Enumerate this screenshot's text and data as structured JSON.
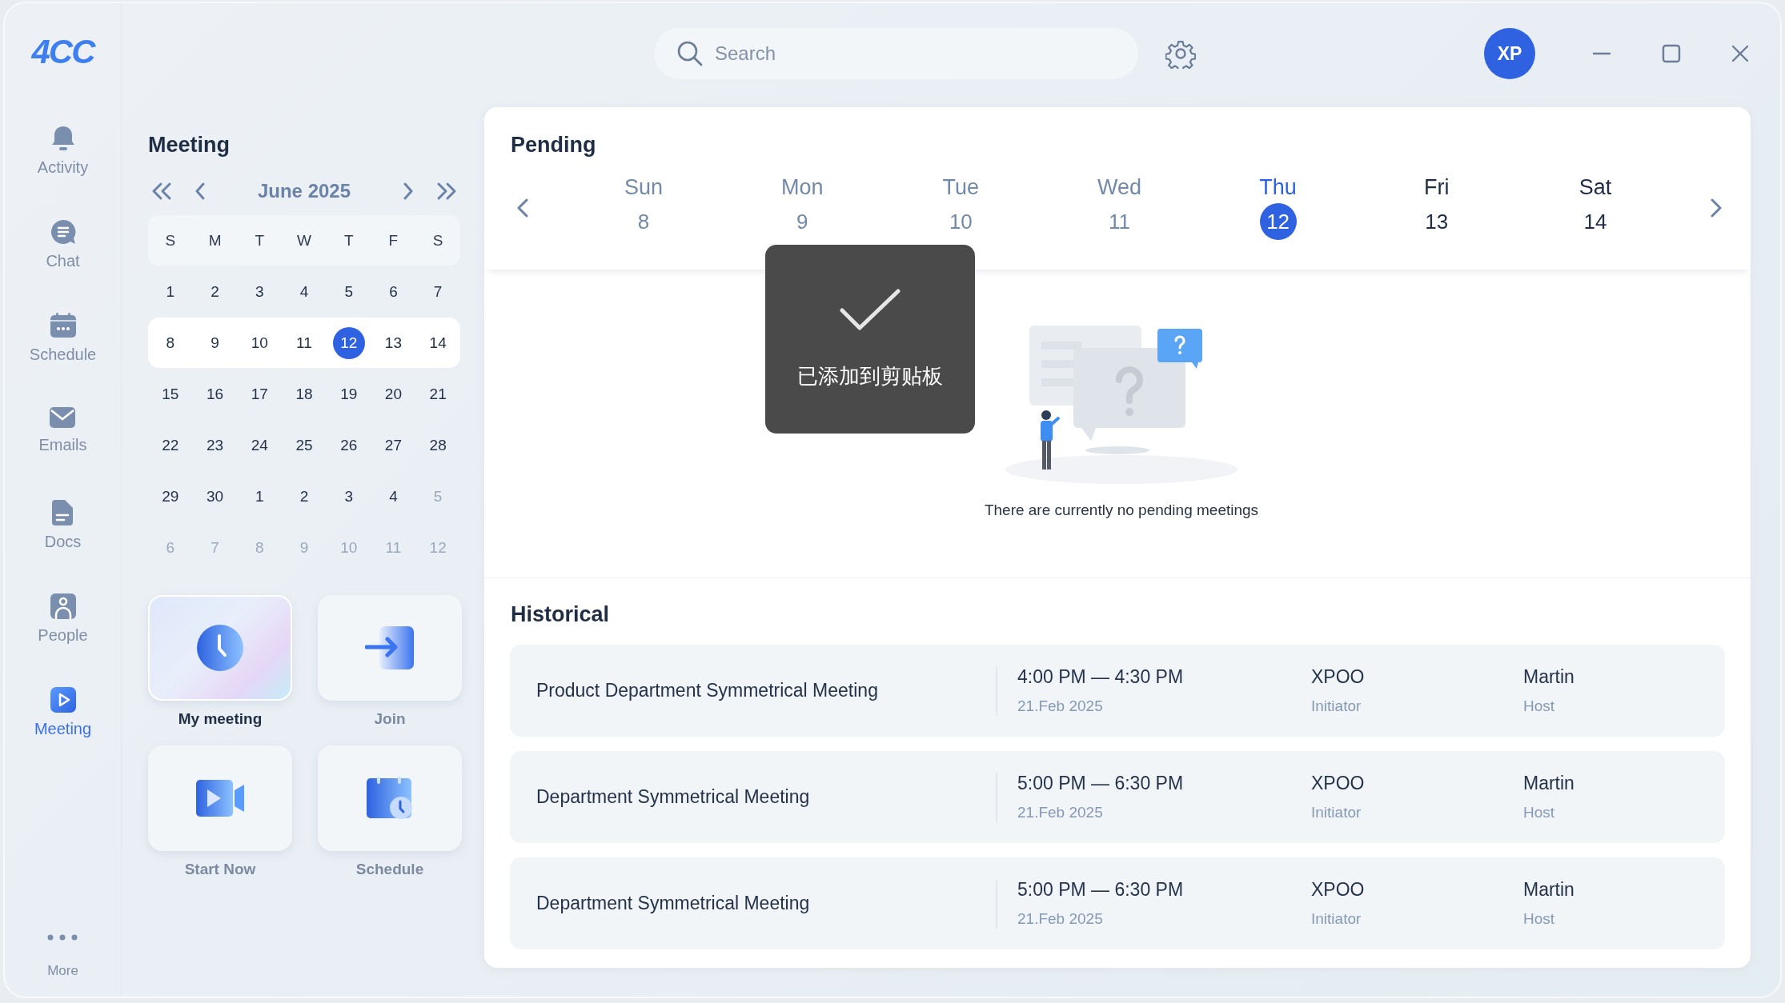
{
  "logo": "4CC",
  "search": {
    "placeholder": "Search"
  },
  "avatar": {
    "initials": "XP"
  },
  "sidebar": {
    "items": [
      {
        "label": "Activity",
        "selected": false
      },
      {
        "label": "Chat",
        "selected": false
      },
      {
        "label": "Schedule",
        "selected": false
      },
      {
        "label": "Emails",
        "selected": false
      },
      {
        "label": "Docs",
        "selected": false
      },
      {
        "label": "People",
        "selected": false
      },
      {
        "label": "Meeting",
        "selected": true
      }
    ],
    "more": {
      "label": "More"
    }
  },
  "meeting_panel": {
    "title": "Meeting",
    "month": "June  2025",
    "weekdays": [
      "S",
      "M",
      "T",
      "W",
      "T",
      "F",
      "S"
    ],
    "weeks": [
      {
        "highlighted": false,
        "days": [
          {
            "day": "1",
            "muted": false,
            "selected": false
          },
          {
            "day": "2",
            "muted": false,
            "selected": false
          },
          {
            "day": "3",
            "muted": false,
            "selected": false
          },
          {
            "day": "4",
            "muted": false,
            "selected": false
          },
          {
            "day": "5",
            "muted": false,
            "selected": false
          },
          {
            "day": "6",
            "muted": false,
            "selected": false
          },
          {
            "day": "7",
            "muted": false,
            "selected": false
          }
        ]
      },
      {
        "highlighted": true,
        "days": [
          {
            "day": "8",
            "muted": false,
            "selected": false
          },
          {
            "day": "9",
            "muted": false,
            "selected": false
          },
          {
            "day": "10",
            "muted": false,
            "selected": false
          },
          {
            "day": "11",
            "muted": false,
            "selected": false
          },
          {
            "day": "12",
            "muted": false,
            "selected": true
          },
          {
            "day": "13",
            "muted": false,
            "selected": false
          },
          {
            "day": "14",
            "muted": false,
            "selected": false
          }
        ]
      },
      {
        "highlighted": false,
        "days": [
          {
            "day": "15",
            "muted": false,
            "selected": false
          },
          {
            "day": "16",
            "muted": false,
            "selected": false
          },
          {
            "day": "17",
            "muted": false,
            "selected": false
          },
          {
            "day": "18",
            "muted": false,
            "selected": false
          },
          {
            "day": "19",
            "muted": false,
            "selected": false
          },
          {
            "day": "20",
            "muted": false,
            "selected": false
          },
          {
            "day": "21",
            "muted": false,
            "selected": false
          }
        ]
      },
      {
        "highlighted": false,
        "days": [
          {
            "day": "22",
            "muted": false,
            "selected": false
          },
          {
            "day": "23",
            "muted": false,
            "selected": false
          },
          {
            "day": "24",
            "muted": false,
            "selected": false
          },
          {
            "day": "25",
            "muted": false,
            "selected": false
          },
          {
            "day": "26",
            "muted": false,
            "selected": false
          },
          {
            "day": "27",
            "muted": false,
            "selected": false
          },
          {
            "day": "28",
            "muted": false,
            "selected": false
          }
        ]
      },
      {
        "highlighted": false,
        "days": [
          {
            "day": "29",
            "muted": false,
            "selected": false
          },
          {
            "day": "30",
            "muted": false,
            "selected": false
          },
          {
            "day": "1",
            "muted": false,
            "selected": false
          },
          {
            "day": "2",
            "muted": false,
            "selected": false
          },
          {
            "day": "3",
            "muted": false,
            "selected": false
          },
          {
            "day": "4",
            "muted": false,
            "selected": false
          },
          {
            "day": "5",
            "muted": true,
            "selected": false
          }
        ]
      },
      {
        "highlighted": false,
        "days": [
          {
            "day": "6",
            "muted": true,
            "selected": false
          },
          {
            "day": "7",
            "muted": true,
            "selected": false
          },
          {
            "day": "8",
            "muted": true,
            "selected": false
          },
          {
            "day": "9",
            "muted": true,
            "selected": false
          },
          {
            "day": "10",
            "muted": true,
            "selected": false
          },
          {
            "day": "11",
            "muted": true,
            "selected": false
          },
          {
            "day": "12",
            "muted": true,
            "selected": false
          }
        ]
      }
    ],
    "tiles": [
      {
        "label": "My meeting",
        "selected": true
      },
      {
        "label": "Join",
        "selected": false
      },
      {
        "label": "Start Now",
        "selected": false
      },
      {
        "label": "Schedule",
        "selected": false
      }
    ]
  },
  "pending": {
    "title": "Pending",
    "days": [
      {
        "name": "Sun",
        "date": "8",
        "past": true,
        "selected": false
      },
      {
        "name": "Mon",
        "date": "9",
        "past": true,
        "selected": false
      },
      {
        "name": "Tue",
        "date": "10",
        "past": true,
        "selected": false
      },
      {
        "name": "Wed",
        "date": "11",
        "past": true,
        "selected": false
      },
      {
        "name": "Thu",
        "date": "12",
        "past": false,
        "selected": true
      },
      {
        "name": "Fri",
        "date": "13",
        "past": false,
        "selected": false
      },
      {
        "name": "Sat",
        "date": "14",
        "past": false,
        "selected": false
      }
    ],
    "empty_message": "There are currently no pending meetings"
  },
  "toast": {
    "text": "已添加到剪贴板"
  },
  "historical": {
    "title": "Historical",
    "rows": [
      {
        "title": "Product Department Symmetrical Meeting",
        "time": "4:00 PM — 4:30 PM",
        "date": "21.Feb 2025",
        "initiator": "XPOO",
        "initiator_label": "Initiator",
        "host": "Martin",
        "host_label": "Host"
      },
      {
        "title": "Department Symmetrical Meeting",
        "time": "5:00 PM — 6:30 PM",
        "date": "21.Feb 2025",
        "initiator": "XPOO",
        "initiator_label": "Initiator",
        "host": "Martin",
        "host_label": "Host"
      },
      {
        "title": "Department Symmetrical Meeting",
        "time": "5:00 PM — 6:30 PM",
        "date": "21.Feb 2025",
        "initiator": "XPOO",
        "initiator_label": "Initiator",
        "host": "Martin",
        "host_label": "Host"
      }
    ]
  }
}
